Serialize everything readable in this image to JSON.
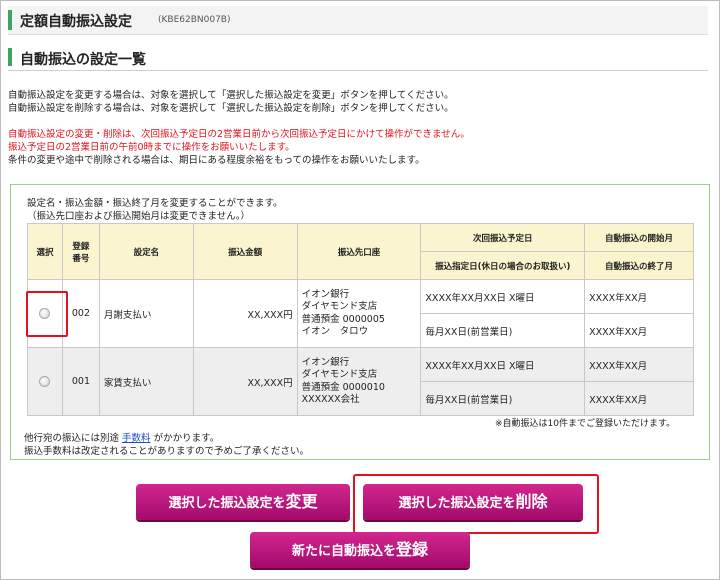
{
  "header": {
    "title": "定額自動振込設定",
    "code": "(KBE62BN007B)"
  },
  "section": {
    "title": "自動振込の設定一覧"
  },
  "instructions": [
    "自動振込設定を変更する場合は、対象を選択して「選択した振込設定を変更」ボタンを押してください。",
    "自動振込設定を削除する場合は、対象を選択して「選択した振込設定を削除」ボタンを押してください。"
  ],
  "warnings": [
    "自動振込設定の変更・削除は、次回振込予定日の2営業日前から次回振込予定日にかけて操作ができません。",
    "振込予定日の2営業日前の午前0時までに操作をお願いいたします。"
  ],
  "warning_note": "条件の変更や途中で削除される場合は、期日にある程度余裕をもっての操作をお願いいたします。",
  "box": {
    "intro1": "設定名・振込金額・振込終了月を変更することができます。",
    "intro2": "（振込先口座および振込開始月は変更できません。）"
  },
  "table": {
    "headers": {
      "select": "選択",
      "reg_no_1": "登録",
      "reg_no_2": "番号",
      "name": "設定名",
      "amount": "振込金額",
      "dest": "振込先口座",
      "next_date": "次回振込予定日",
      "specified": "振込指定日(休日の場合のお取扱い)",
      "start_month": "自動振込の開始月",
      "end_month": "自動振込の終了月"
    },
    "rows": [
      {
        "no": "002",
        "name": "月謝支払い",
        "amount": "XX,XXX円",
        "dest": [
          "イオン銀行",
          "ダイヤモンド支店",
          "普通預金 0000005",
          "イオン　タロウ"
        ],
        "next_date": "XXXX年XX月XX日 X曜日",
        "specified": "毎月XX日(前営業日)",
        "start": "XXXX年XX月",
        "end": "XXXX年XX月"
      },
      {
        "no": "001",
        "name": "家賃支払い",
        "amount": "XX,XXX円",
        "dest": [
          "イオン銀行",
          "ダイヤモンド支店",
          "普通預金 0000010",
          "XXXXXX会社"
        ],
        "next_date": "XXXX年XX月XX日 X曜日",
        "specified": "毎月XX日(前営業日)",
        "start": "XXXX年XX月",
        "end": "XXXX年XX月"
      }
    ]
  },
  "limit_note": "※自動振込は10件までご登録いただけます。",
  "fee": {
    "pre": "他行宛の振込には別途 ",
    "link": "手数料",
    "post": " がかかります。",
    "line2": "振込手数料は改定されることがありますので予めご了承ください。"
  },
  "buttons": {
    "change_pre": "選択した振込設定を",
    "change_big": "変更",
    "delete_pre": "選択した振込設定を",
    "delete_big": "削除",
    "register_pre": "新たに自動振込を",
    "register_big": "登録"
  },
  "colors": {
    "accent_green": "#3aa660",
    "button_magenta": "#b8137a",
    "warning_red": "#e0121b",
    "header_yellow": "#fbf5cf"
  }
}
